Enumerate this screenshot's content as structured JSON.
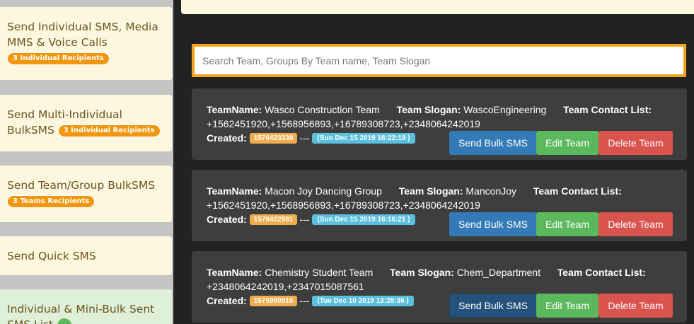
{
  "sidebar": {
    "items": [
      {
        "label_line1": "Send Individual SMS, Media",
        "label_line2": "MMS & Voice Calls",
        "pill": "3 Individual Recipients"
      },
      {
        "label_line1": "Send Multi-Individual",
        "label_line2": "BulkSMS",
        "pill": "3 Individual Recipients"
      },
      {
        "label_line1": "Send Team/Group BulkSMS",
        "pill": "3 Teams Recipients"
      },
      {
        "label_line1": "Send Quick SMS"
      },
      {
        "label_line1": "Individual & Mini-Bulk Sent",
        "label_line2": "SMS List"
      }
    ]
  },
  "search": {
    "placeholder": "Search Team, Groups By Team name, Team Slogan",
    "value": ""
  },
  "labels": {
    "team_name": "TeamName:",
    "team_slogan": "Team Slogan:",
    "contact_list": "Team Contact List:",
    "created": "Created:",
    "separator": "---"
  },
  "teams": [
    {
      "name": "Wasco Construction Team",
      "slogan": "WascoEngineering",
      "contacts": "+1562451920,+1568956893,+16789308723,+2348064242019",
      "timestamp": "1576423339",
      "date": "(Sun Dec 15 2019 16:22:19 )",
      "send_label": "Send Bulk SMS",
      "edit_label": "Edit Team",
      "delete_label": "Delete Team"
    },
    {
      "name": "Macon Joy Dancing Group",
      "slogan": "ManconJoy",
      "contacts": "+1562451920,+1568956893,+16789308723,+2348064242019",
      "timestamp": "1576422981",
      "date": "(Sun Dec 15 2019 16:16:21 )",
      "send_label": "Send Bulk SMS",
      "edit_label": "Edit Team",
      "delete_label": "Delete Team"
    },
    {
      "name": "Chemistry Student Team",
      "slogan": "Chem_Department",
      "contacts": "+2348064242019,+2347015087561",
      "timestamp": "1575980916",
      "date": "(Tue Dec 10 2019 13:28:36 )",
      "send_label": "Send Bulk SMS",
      "edit_label": "Edit Team",
      "delete_label": "Delete Team"
    }
  ],
  "colors": {
    "accent_orange": "#f4a31b",
    "primary_blue": "#337ab7",
    "success_green": "#5cb85c",
    "danger_red": "#d9534f",
    "info_cyan": "#5bc0de",
    "sidebar_bg": "#fdf7e0"
  }
}
